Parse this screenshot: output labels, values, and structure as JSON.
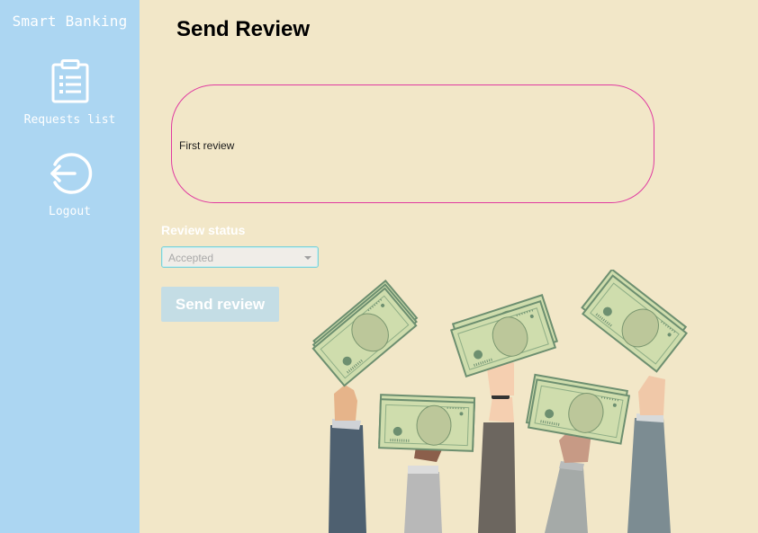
{
  "sidebar": {
    "app_title": "Smart Banking",
    "items": [
      {
        "label": "Requests list",
        "icon": "clipboard-list-icon"
      },
      {
        "label": "Logout",
        "icon": "logout-icon"
      }
    ]
  },
  "main": {
    "title": "Send Review",
    "review_text": "First review",
    "status_label": "Review status",
    "status_value": "Accepted",
    "send_label": "Send review"
  },
  "colors": {
    "sidebar_bg": "#acd6f2",
    "page_bg": "#f2e7c8",
    "review_border": "#e03aa0",
    "button_bg": "#c4dde5",
    "money": "#cfddad"
  }
}
